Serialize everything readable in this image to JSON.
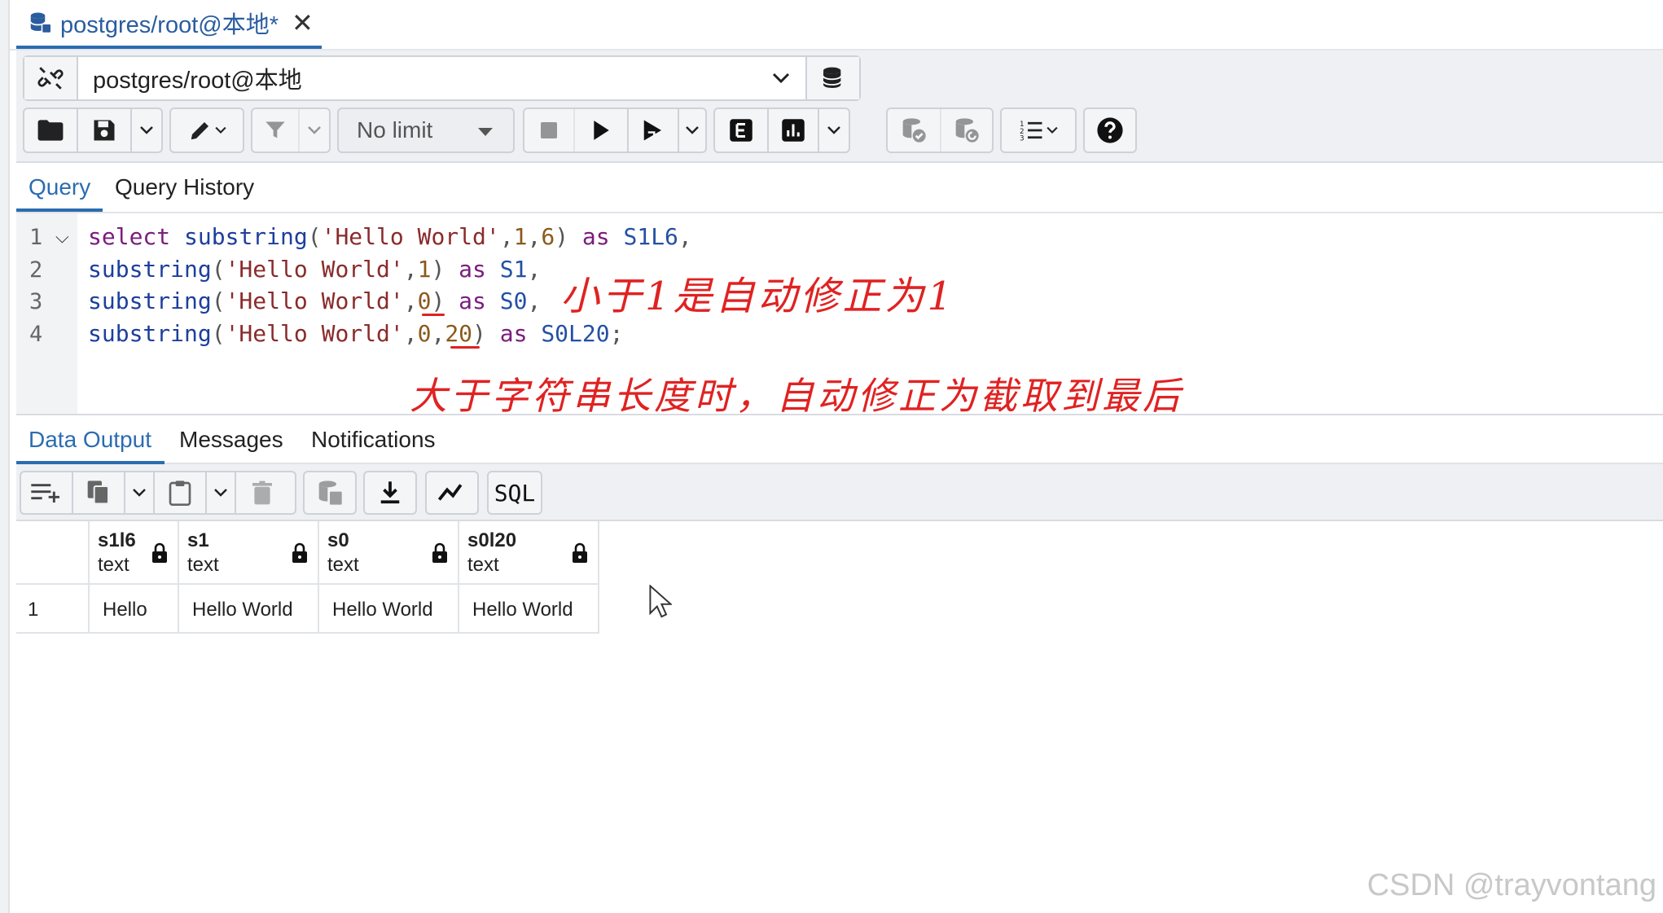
{
  "doc_tab": {
    "title": "postgres/root@本地*",
    "close": "✕"
  },
  "connection": {
    "label": "postgres/root@本地"
  },
  "toolbar": {
    "limit_label": "No limit"
  },
  "query_tabs": [
    {
      "label": "Query"
    },
    {
      "label": "Query History"
    }
  ],
  "editor": {
    "line_numbers": [
      "1",
      "2",
      "3",
      "4"
    ],
    "lines": [
      [
        {
          "t": "select ",
          "c": "kw"
        },
        {
          "t": "substring",
          "c": "fn"
        },
        {
          "t": "(",
          "c": "pun"
        },
        {
          "t": "'Hello World'",
          "c": "str"
        },
        {
          "t": ",",
          "c": "pun"
        },
        {
          "t": "1",
          "c": "num"
        },
        {
          "t": ",",
          "c": "pun"
        },
        {
          "t": "6",
          "c": "num"
        },
        {
          "t": ") ",
          "c": "pun"
        },
        {
          "t": "as ",
          "c": "kw"
        },
        {
          "t": "S1L6",
          "c": "id"
        },
        {
          "t": ",",
          "c": "pun"
        }
      ],
      [
        {
          "t": "substring",
          "c": "fn"
        },
        {
          "t": "(",
          "c": "pun"
        },
        {
          "t": "'Hello World'",
          "c": "str"
        },
        {
          "t": ",",
          "c": "pun"
        },
        {
          "t": "1",
          "c": "num"
        },
        {
          "t": ") ",
          "c": "pun"
        },
        {
          "t": "as ",
          "c": "kw"
        },
        {
          "t": "S1",
          "c": "id"
        },
        {
          "t": ",",
          "c": "pun"
        }
      ],
      [
        {
          "t": "substring",
          "c": "fn"
        },
        {
          "t": "(",
          "c": "pun"
        },
        {
          "t": "'Hello World'",
          "c": "str"
        },
        {
          "t": ",",
          "c": "pun"
        },
        {
          "t": "0",
          "c": "num"
        },
        {
          "t": ") ",
          "c": "pun"
        },
        {
          "t": "as ",
          "c": "kw"
        },
        {
          "t": "S0",
          "c": "id"
        },
        {
          "t": ",",
          "c": "pun"
        }
      ],
      [
        {
          "t": "substring",
          "c": "fn"
        },
        {
          "t": "(",
          "c": "pun"
        },
        {
          "t": "'Hello World'",
          "c": "str"
        },
        {
          "t": ",",
          "c": "pun"
        },
        {
          "t": "0",
          "c": "num"
        },
        {
          "t": ",",
          "c": "pun"
        },
        {
          "t": "20",
          "c": "num"
        },
        {
          "t": ") ",
          "c": "pun"
        },
        {
          "t": "as ",
          "c": "kw"
        },
        {
          "t": "S0L20",
          "c": "id"
        },
        {
          "t": ";",
          "c": "pun"
        }
      ]
    ]
  },
  "annotations": {
    "note1": "小于1是自动修正为1",
    "note2": "大于字符串长度时，自动修正为截取到最后"
  },
  "output_tabs": [
    {
      "label": "Data Output"
    },
    {
      "label": "Messages"
    },
    {
      "label": "Notifications"
    }
  ],
  "output_toolbar": {
    "sql_label": "SQL"
  },
  "grid": {
    "columns": [
      {
        "name": "s1l6",
        "type": "text"
      },
      {
        "name": "s1",
        "type": "text"
      },
      {
        "name": "s0",
        "type": "text"
      },
      {
        "name": "s0l20",
        "type": "text"
      }
    ],
    "rows": [
      {
        "num": "1",
        "cells": [
          "Hello",
          "Hello World",
          "Hello World",
          "Hello World"
        ]
      }
    ]
  },
  "watermark": "CSDN @trayvontang",
  "colors": {
    "accent": "#2b6cb0",
    "annotation": "#e02222",
    "keyword": "#7a1d7e",
    "function": "#1d3f9c"
  }
}
